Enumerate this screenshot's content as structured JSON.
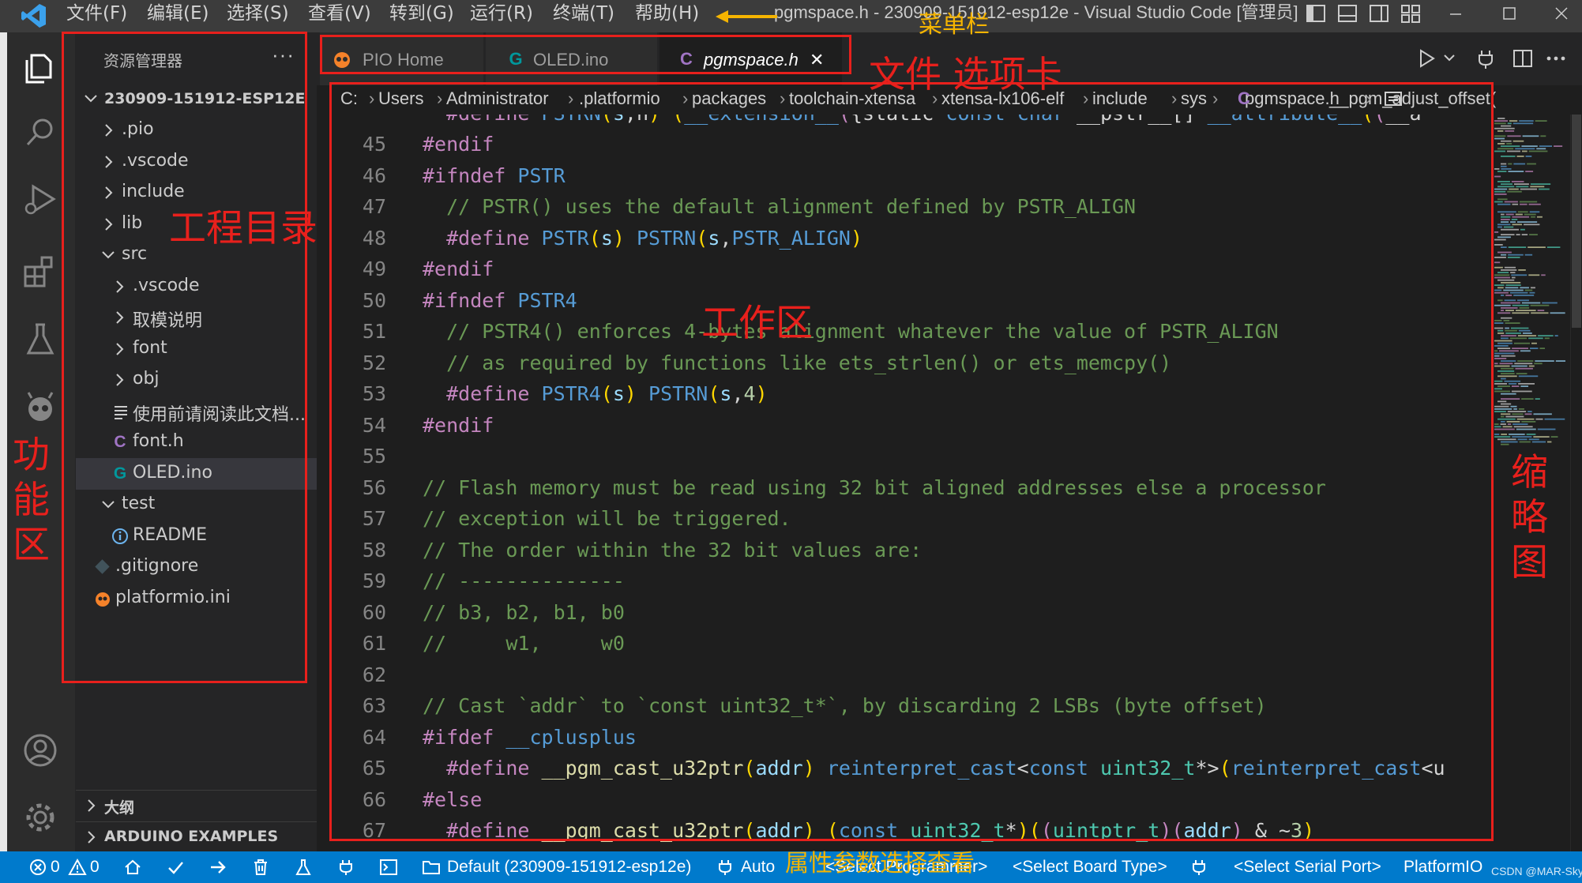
{
  "menubar": {
    "items": [
      "文件(F)",
      "编辑(E)",
      "选择(S)",
      "查看(V)",
      "转到(G)",
      "运行(R)",
      "终端(T)",
      "帮助(H)"
    ],
    "window_title": "pgmspace.h - 230909-151912-esp12e - Visual Studio Code [管理员]"
  },
  "activity_bar": {
    "icons": [
      "explorer-icon",
      "search-icon",
      "run-debug-icon",
      "extensions-icon",
      "testing-icon",
      "platformio-icon",
      "account-icon",
      "settings-gear-icon"
    ]
  },
  "sidebar": {
    "title": "资源管理器",
    "more": "···",
    "project_root": "230909-151912-ESP12E",
    "tree": [
      {
        "label": ".pio",
        "type": "folder",
        "expanded": false,
        "depth": 1
      },
      {
        "label": ".vscode",
        "type": "folder",
        "expanded": false,
        "depth": 1
      },
      {
        "label": "include",
        "type": "folder",
        "expanded": false,
        "depth": 1
      },
      {
        "label": "lib",
        "type": "folder",
        "expanded": false,
        "depth": 1
      },
      {
        "label": "src",
        "type": "folder",
        "expanded": true,
        "depth": 1
      },
      {
        "label": ".vscode",
        "type": "folder",
        "expanded": false,
        "depth": 2
      },
      {
        "label": "取模说明",
        "type": "folder",
        "expanded": false,
        "depth": 2
      },
      {
        "label": "font",
        "type": "folder",
        "expanded": false,
        "depth": 2
      },
      {
        "label": "obj",
        "type": "folder",
        "expanded": false,
        "depth": 2
      },
      {
        "label": "使用前请阅读此文档...",
        "type": "text-file",
        "depth": 2
      },
      {
        "label": "font.h",
        "type": "c-file",
        "depth": 2
      },
      {
        "label": "OLED.ino",
        "type": "arduino-file",
        "depth": 2,
        "active": true
      },
      {
        "label": "test",
        "type": "folder",
        "expanded": true,
        "depth": 1
      },
      {
        "label": "README",
        "type": "info-file",
        "depth": 2
      },
      {
        "label": ".gitignore",
        "type": "git-file",
        "depth": 1
      },
      {
        "label": "platformio.ini",
        "type": "pio-file",
        "depth": 1
      }
    ],
    "sections": [
      "大纲",
      "ARDUINO EXAMPLES"
    ]
  },
  "tabs": [
    {
      "label": "PIO Home",
      "icon": "platformio-icon"
    },
    {
      "label": "OLED.ino",
      "icon": "arduino-icon"
    },
    {
      "label": "pgmspace.h",
      "icon": "c-file-icon",
      "active": true,
      "close": "✕"
    }
  ],
  "editor_actions": [
    "run-icon",
    "chevron-down-icon",
    "plug-icon",
    "split-editor-icon",
    "more-actions-icon"
  ],
  "breadcrumbs": [
    "C:",
    "Users",
    "Administrator",
    ".platformio",
    "packages",
    "toolchain-xtensa",
    "xtensa-lx106-elf",
    "include",
    "sys",
    "pgmspace.h",
    "__pgm_adjust_offset("
  ],
  "breadcrumb_sep": "›",
  "code": {
    "top_partial": "  #define PSTRN(s,n) (__extension__({static const char __pstr__[] __attribute__((__a",
    "lines": [
      {
        "n": "45",
        "text": "#endif"
      },
      {
        "n": "46",
        "text": "#ifndef PSTR"
      },
      {
        "n": "47",
        "text": "  // PSTR() uses the default alignment defined by PSTR_ALIGN"
      },
      {
        "n": "48",
        "text": "  #define PSTR(s) PSTRN(s,PSTR_ALIGN)"
      },
      {
        "n": "49",
        "text": "#endif"
      },
      {
        "n": "50",
        "text": "#ifndef PSTR4"
      },
      {
        "n": "51",
        "text": "  // PSTR4() enforces 4-bytes alignment whatever the value of PSTR_ALIGN"
      },
      {
        "n": "52",
        "text": "  // as required by functions like ets_strlen() or ets_memcpy()"
      },
      {
        "n": "53",
        "text": "  #define PSTR4(s) PSTRN(s,4)"
      },
      {
        "n": "54",
        "text": "#endif"
      },
      {
        "n": "55",
        "text": ""
      },
      {
        "n": "56",
        "text": "// Flash memory must be read using 32 bit aligned addresses else a processor"
      },
      {
        "n": "57",
        "text": "// exception will be triggered."
      },
      {
        "n": "58",
        "text": "// The order within the 32 bit values are:"
      },
      {
        "n": "59",
        "text": "// --------------"
      },
      {
        "n": "60",
        "text": "// b3, b2, b1, b0"
      },
      {
        "n": "61",
        "text": "//     w1,     w0"
      },
      {
        "n": "62",
        "text": ""
      },
      {
        "n": "63",
        "text": "// Cast `addr` to `const uint32_t*`, by discarding 2 LSBs (byte offset)"
      },
      {
        "n": "64",
        "text": "#ifdef __cplusplus"
      },
      {
        "n": "65",
        "text": "  #define __pgm_cast_u32ptr(addr) reinterpret_cast<const uint32_t*>(reinterpret_cast<u"
      },
      {
        "n": "66",
        "text": "#else"
      },
      {
        "n": "67",
        "text": "  #define __pgm_cast_u32ptr(addr) (const uint32_t*)((uintptr_t)(addr) & ~3)"
      }
    ]
  },
  "statusbar": {
    "errors": "0",
    "warnings": "0",
    "env": "Default (230909-151912-esp12e)",
    "auto": "Auto",
    "programmer": "<Select Programmer>",
    "board": "<Select Board Type>",
    "serial_port": "<Select Serial Port>",
    "platformio": "PlatformIO",
    "watermark": "CSDN @MAR-Sky"
  },
  "annotations": {
    "menubar": "菜单栏",
    "tabs": "文件 选项卡",
    "project_dir": "工程目录",
    "functions": "功能区",
    "workspace": "工作区",
    "minimap": "缩略图",
    "statusbar": "属性参数选择查看"
  },
  "colors": {
    "accent": "#007acc",
    "annotation_red": "#e8201c",
    "annotation_yellow": "#f5b400"
  }
}
